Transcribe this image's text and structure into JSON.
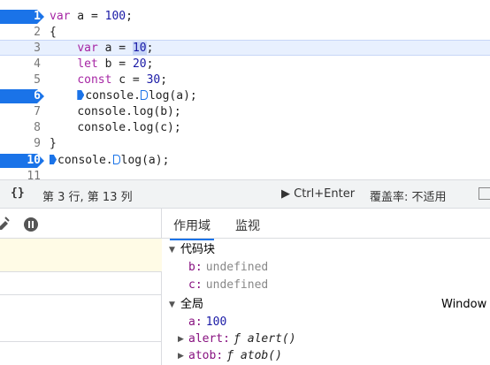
{
  "editor": {
    "lines": [
      {
        "num": "1",
        "breakpoint": true
      },
      {
        "num": "2",
        "breakpoint": false
      },
      {
        "num": "3",
        "breakpoint": false
      },
      {
        "num": "4",
        "breakpoint": false
      },
      {
        "num": "5",
        "breakpoint": false
      },
      {
        "num": "6",
        "breakpoint": true
      },
      {
        "num": "7",
        "breakpoint": false
      },
      {
        "num": "8",
        "breakpoint": false
      },
      {
        "num": "9",
        "breakpoint": false
      },
      {
        "num": "10",
        "breakpoint": true
      },
      {
        "num": "11",
        "breakpoint": false
      }
    ],
    "code": {
      "l1_kw": "var",
      "l1_rest": " a = ",
      "l1_num": "100",
      "l1_end": ";",
      "l2": "{",
      "l3_kw": "var",
      "l3_rest": " a = ",
      "l3_num": "10",
      "l3_end": ";",
      "l4_kw": "let",
      "l4_rest": " b = ",
      "l4_num": "20",
      "l4_end": ";",
      "l5_kw": "const",
      "l5_rest": " c = ",
      "l5_num": "30",
      "l5_end": ";",
      "l6_a": "console.",
      "l6_b": "log(a);",
      "l7": "console.log(b);",
      "l8": "console.log(c);",
      "l9": "}",
      "l10_a": "console.",
      "l10_b": "log(a);"
    }
  },
  "statusbar": {
    "braces": "{}",
    "position": "第 3 行, 第 13 列",
    "run_label": "▶ Ctrl+Enter",
    "coverage": "覆盖率: 不适用"
  },
  "tabs": {
    "scope": "作用域",
    "watch": "监视"
  },
  "scope": {
    "block_title": "代码块",
    "block_items": [
      {
        "name": "b",
        "value": "undefined"
      },
      {
        "name": "c",
        "value": "undefined"
      }
    ],
    "global_title": "全局",
    "global_value": "Window",
    "global_items": [
      {
        "name": "a",
        "value": "100"
      },
      {
        "name": "alert",
        "value": "ƒ alert()"
      },
      {
        "name": "atob",
        "value": "ƒ atob()"
      }
    ]
  },
  "colors": {
    "accent": "#1a73e8",
    "current_line": "#e8f0fe"
  }
}
